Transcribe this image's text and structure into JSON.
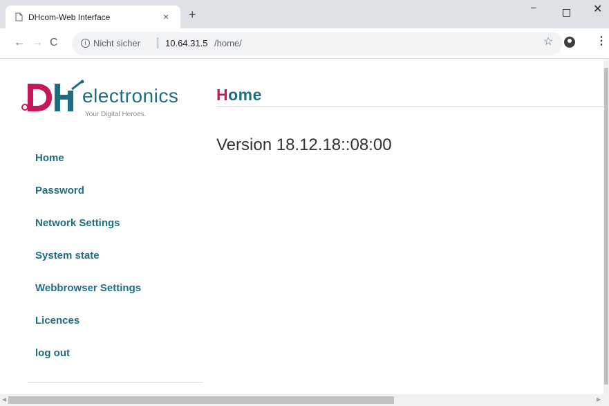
{
  "browser": {
    "tab_title": "DHcom-Web Interface",
    "tab_close": "×",
    "new_tab": "+",
    "window_minimize": "–",
    "window_close": "✕",
    "back": "←",
    "forward": "→",
    "reload": "C",
    "security_text": "Nicht sicher",
    "url_host": "10.64.31.5",
    "url_path": "/home/",
    "bookmark_icon": "☆",
    "menu_icon": "⋮"
  },
  "logo": {
    "brand": "DH",
    "name": "electronics",
    "tagline": "Your Digital Heroes.",
    "colors": {
      "magenta": "#c7175b",
      "teal": "#1e6d80"
    }
  },
  "sidebar": {
    "items": [
      {
        "label": "Home"
      },
      {
        "label": "Password"
      },
      {
        "label": "Network Settings"
      },
      {
        "label": "System state"
      },
      {
        "label": "Webbrowser Settings"
      },
      {
        "label": "Licences"
      },
      {
        "label": "log out"
      }
    ]
  },
  "main": {
    "heading_first": "H",
    "heading_rest": "ome",
    "version": "Version 18.12.18::08:00"
  }
}
